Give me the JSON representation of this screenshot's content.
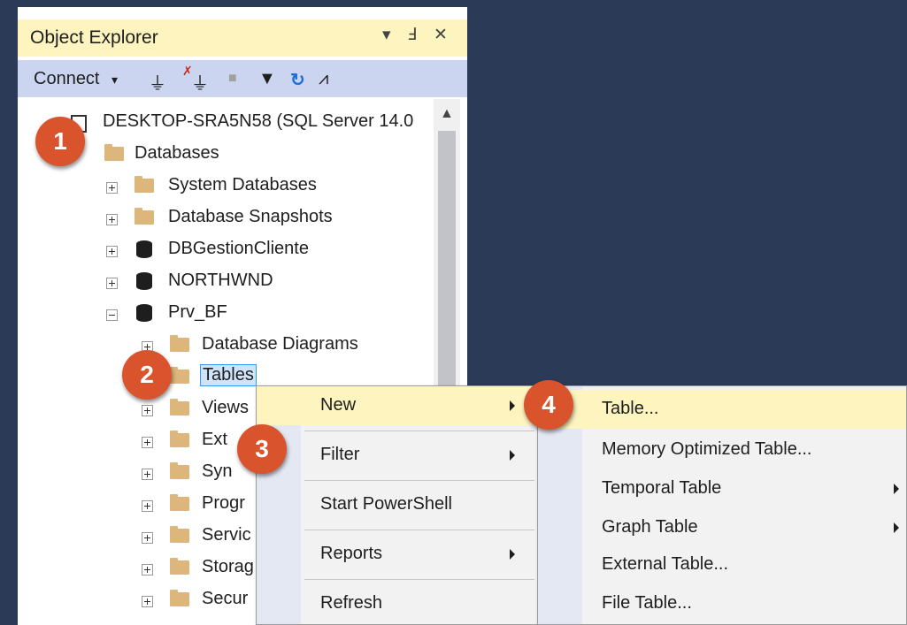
{
  "object_explorer": {
    "title": "Object Explorer",
    "title_buttons": {
      "dropdown": "▾",
      "pin": "Ⅎ",
      "close": "✕"
    },
    "toolbar": {
      "connect_label": "Connect",
      "connect_arrow": "▾",
      "icons": [
        "connect-plug-icon",
        "disconnect-plug-icon",
        "stop-icon",
        "filter-icon",
        "refresh-icon",
        "activity-monitor-icon"
      ],
      "glyphs": {
        "plug": "⏚",
        "disconnect": "✗",
        "stop": "■",
        "filter": "▼",
        "refresh": "↻",
        "activity": "⩘"
      }
    },
    "tree": {
      "server": "DESKTOP-SRA5N58 (SQL Server 14.0",
      "databases": "Databases",
      "system_databases": "System Databases",
      "database_snapshots": "Database Snapshots",
      "db1": "DBGestionCliente",
      "db2": "NORTHWND",
      "db3": "Prv_BF",
      "database_diagrams": "Database Diagrams",
      "tables": "Tables",
      "views": "Views",
      "external": "Ext",
      "synonyms": "Syn",
      "programmability": "Progr",
      "service": "Servic",
      "storage": "Storag",
      "security": "Secur"
    }
  },
  "context_menu": {
    "items": [
      "New",
      "Filter",
      "Start PowerShell",
      "Reports",
      "Refresh"
    ]
  },
  "submenu": {
    "items": [
      "Table...",
      "Memory Optimized Table...",
      "Temporal Table",
      "Graph Table",
      "External Table...",
      "File Table..."
    ]
  },
  "badges": [
    "1",
    "2",
    "3",
    "4"
  ],
  "colors": {
    "accent_badge": "#d9532c",
    "highlight": "#fdf4bf",
    "background": "#2b3a57",
    "toolbar": "#ccd5f0",
    "folder": "#dcb67a"
  }
}
